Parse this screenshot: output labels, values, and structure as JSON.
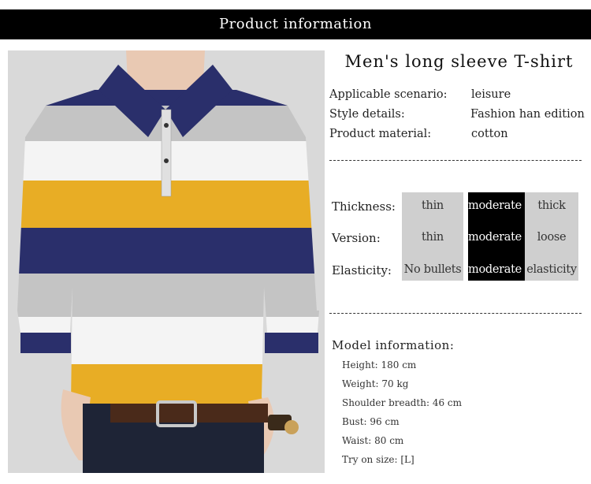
{
  "header": {
    "title": "Product information"
  },
  "product": {
    "title": "Men's long sleeve T-shirt"
  },
  "specs": [
    {
      "label": "Applicable scenario:",
      "value": "leisure"
    },
    {
      "label": "Style details:",
      "value": "Fashion han edition"
    },
    {
      "label": "Product material:",
      "value": "cotton"
    }
  ],
  "attributes": [
    {
      "label": "Thickness:",
      "options": [
        "thin",
        "moderate",
        "thick"
      ],
      "selected_index": 1
    },
    {
      "label": "Version:",
      "options": [
        "thin",
        "moderate",
        "loose"
      ],
      "selected_index": 1
    },
    {
      "label": "Elasticity:",
      "options": [
        "No bullets",
        "moderate",
        "elasticity"
      ],
      "selected_index": 1
    }
  ],
  "model": {
    "title": "Model information:",
    "items": [
      "Height: 180 cm",
      "Weight: 70 kg",
      "Shoulder breadth: 46 cm",
      "Bust: 96 cm",
      "Waist: 80 cm",
      "Try on size: [L]"
    ]
  },
  "colors": {
    "navy": "#2a2f6b",
    "grey": "#c4c4c4",
    "white": "#f4f4f4",
    "yellow": "#e8ad25",
    "selected_bg": "#000000",
    "option_bg": "#cfcfcf"
  }
}
